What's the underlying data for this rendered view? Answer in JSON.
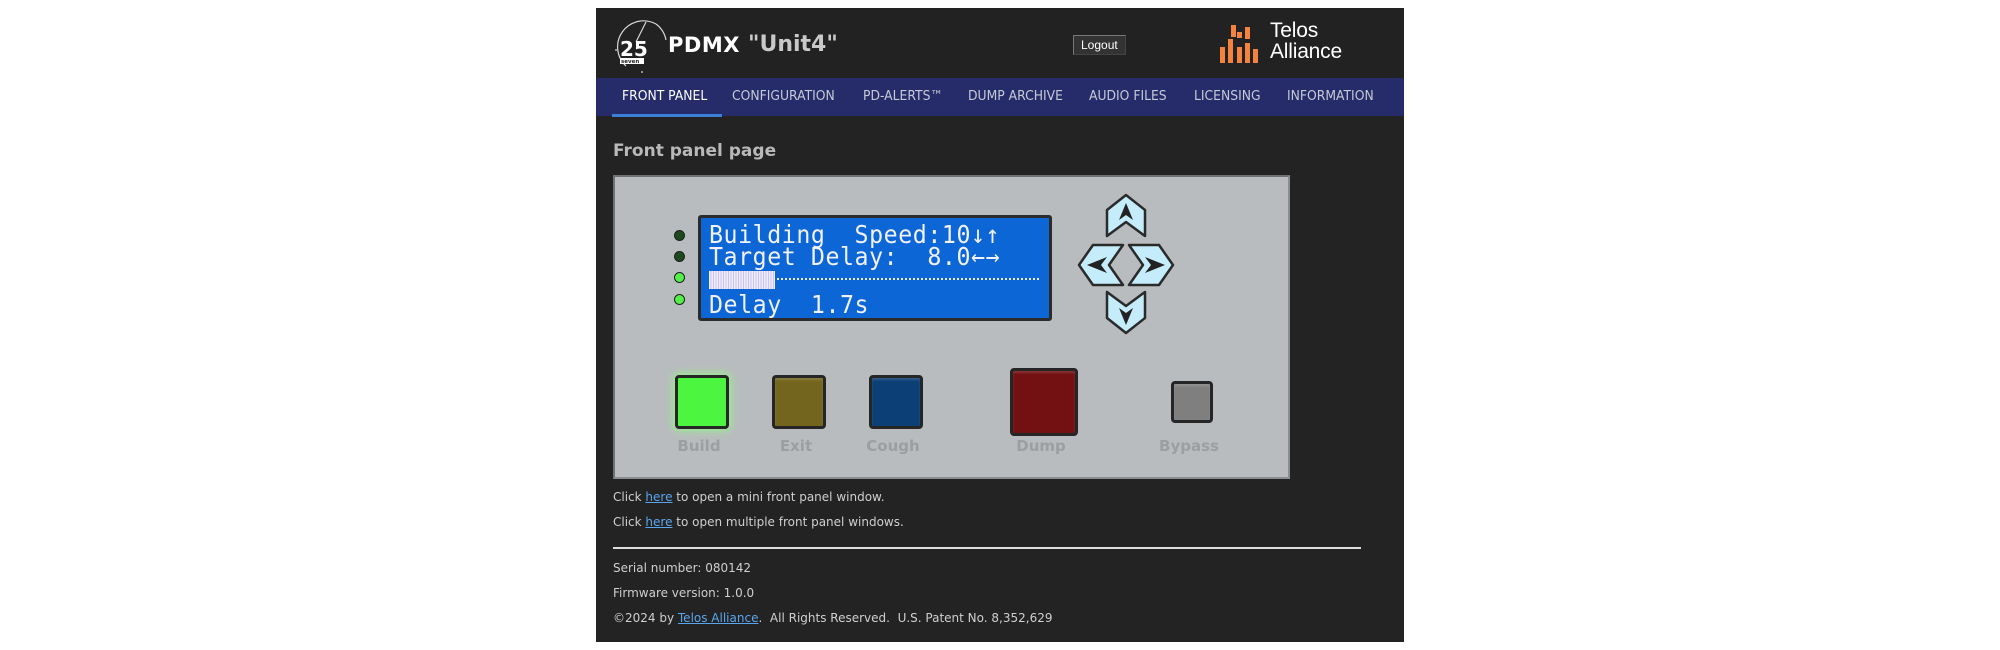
{
  "header": {
    "brand_logo": "25-seven",
    "product": "PDMX",
    "unit_name": "\"Unit4\"",
    "logout_label": "Logout",
    "partner_logo_line1": "Telos",
    "partner_logo_line2": "Alliance"
  },
  "nav": {
    "items": [
      {
        "label": "FRONT PANEL",
        "active": true
      },
      {
        "label": "CONFIGURATION",
        "active": false
      },
      {
        "label": "PD-ALERTS™",
        "active": false
      },
      {
        "label": "DUMP ARCHIVE",
        "active": false
      },
      {
        "label": "AUDIO FILES",
        "active": false
      },
      {
        "label": "LICENSING",
        "active": false
      },
      {
        "label": "INFORMATION",
        "active": false
      }
    ]
  },
  "main": {
    "page_title": "Front panel page",
    "front_panel": {
      "leds": [
        {
          "state": "off",
          "color": "#1c4a1d"
        },
        {
          "state": "off",
          "color": "#1c4a1d"
        },
        {
          "state": "on",
          "color": "#54f04a"
        },
        {
          "state": "on",
          "color": "#54f04a"
        }
      ],
      "lcd": {
        "line1": "Building  Speed:10↓↑",
        "line2": "Target Delay:  8.0←→",
        "progress_fraction": 0.2,
        "line4": "Delay  1.7s",
        "background_color": "#0d66d6"
      },
      "arrows": [
        "up-arrow",
        "left-arrow",
        "right-arrow",
        "down-arrow"
      ],
      "buttons": [
        {
          "label": "Build",
          "color": "#4cf53f",
          "lit": true
        },
        {
          "label": "Exit",
          "color": "#74651e",
          "lit": false
        },
        {
          "label": "Cough",
          "color": "#0b3f75",
          "lit": false
        },
        {
          "label": "Dump",
          "color": "#731012",
          "lit": false
        },
        {
          "label": "Bypass",
          "color": "#7f7f7f",
          "lit": false
        }
      ]
    },
    "links": [
      {
        "prefix": "Click ",
        "link_text": "here",
        "suffix": " to open a mini front panel window."
      },
      {
        "prefix": "Click ",
        "link_text": "here",
        "suffix": " to open multiple front panel windows."
      }
    ]
  },
  "footer": {
    "serial": "Serial number: 080142",
    "firmware": "Firmware version: 1.0.0",
    "copyright_prefix": "©2024 by ",
    "copyright_link": "Telos Alliance",
    "copyright_suffix": ".  All Rights Reserved.  U.S. Patent No. 8,352,629"
  }
}
